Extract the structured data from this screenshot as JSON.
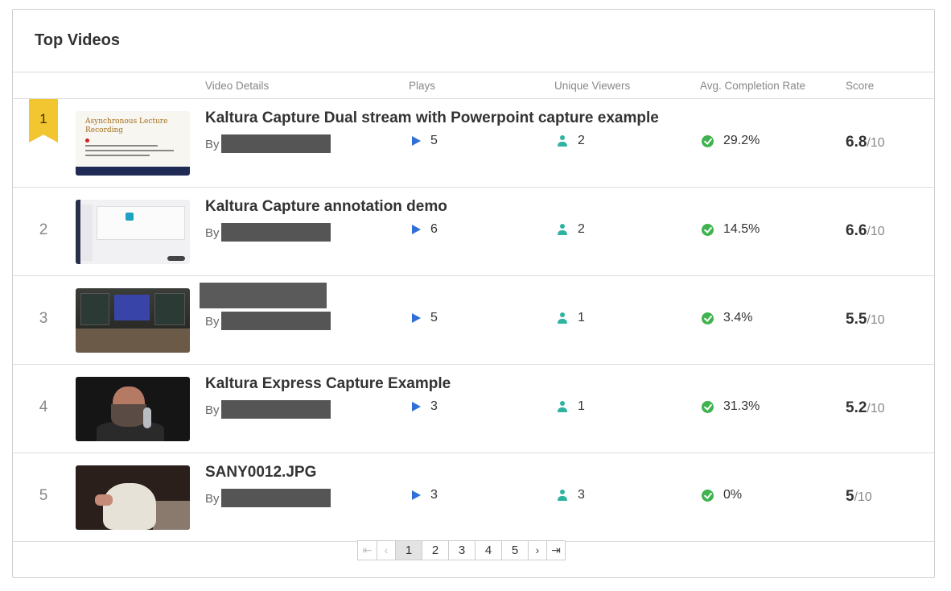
{
  "panel": {
    "title": "Top Videos"
  },
  "columns": {
    "details": "Video Details",
    "plays": "Plays",
    "viewers": "Unique Viewers",
    "completion": "Avg. Completion Rate",
    "score": "Score"
  },
  "rows": [
    {
      "rank": "1",
      "title": "Kaltura Capture Dual stream with Powerpoint capture example",
      "by": "By",
      "plays": "5",
      "viewers": "2",
      "completion": "29.2%",
      "score": "6.8",
      "score_max": "/10",
      "thumb_text": "Asynchronous Lecture Recording"
    },
    {
      "rank": "2",
      "title": "Kaltura Capture annotation demo",
      "by": "By",
      "plays": "6",
      "viewers": "2",
      "completion": "14.5%",
      "score": "6.6",
      "score_max": "/10"
    },
    {
      "rank": "3",
      "title": "",
      "by": "By",
      "plays": "5",
      "viewers": "1",
      "completion": "3.4%",
      "score": "5.5",
      "score_max": "/10"
    },
    {
      "rank": "4",
      "title": "Kaltura Express Capture Example",
      "by": "By",
      "plays": "3",
      "viewers": "1",
      "completion": "31.3%",
      "score": "5.2",
      "score_max": "/10"
    },
    {
      "rank": "5",
      "title": "SANY0012.JPG",
      "by": "By",
      "plays": "3",
      "viewers": "3",
      "completion": "0%",
      "score": "5",
      "score_max": "/10"
    }
  ],
  "pagination": {
    "first": "⇤",
    "prev": "‹",
    "pages": [
      "1",
      "2",
      "3",
      "4",
      "5"
    ],
    "current": "1",
    "next": "›",
    "last": "⇥"
  },
  "icons": {
    "rank_badge": "ribbon-badge-icon",
    "play": "play-icon",
    "viewer": "user-icon",
    "completion": "check-circle-icon"
  },
  "colors": {
    "badge": "#f2c630",
    "play": "#2f6fd6",
    "viewer": "#2eb3a0",
    "completion": "#3fb34f"
  }
}
